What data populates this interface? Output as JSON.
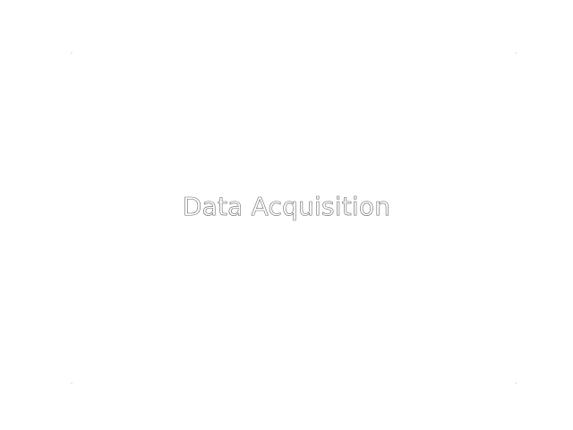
{
  "splash": {
    "title": "Data Acquisition"
  },
  "colors": {
    "background": "#ffffff",
    "title_outline": "#6a6a6a",
    "title_fill": "#ffffff"
  }
}
